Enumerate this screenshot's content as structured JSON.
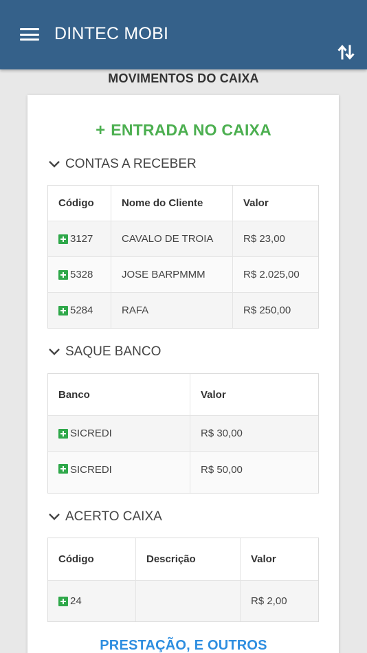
{
  "appbar": {
    "title": "DINTEC MOBI",
    "menu_icon": "hamburger-menu-icon",
    "sort_icon": "swap-vertical-icon",
    "color": "#35618a"
  },
  "page": {
    "title": "MOVIMENTOS DO CAIXA"
  },
  "entry": {
    "plus": "+",
    "title": "ENTRADA NO CAIXA",
    "color": "#4caf50"
  },
  "contas_receber": {
    "title": "CONTAS A RECEBER",
    "columns": [
      "Código",
      "Nome do Cliente",
      "Valor"
    ],
    "rows": [
      {
        "codigo": "3127",
        "nome": "CAVALO DE TROIA",
        "valor": "R$ 23,00"
      },
      {
        "codigo": "5328",
        "nome": "JOSE BARPMMM",
        "valor": "R$ 2.025,00"
      },
      {
        "codigo": "5284",
        "nome": "RAFA",
        "valor": "R$ 250,00"
      }
    ]
  },
  "saque_banco": {
    "title": "SAQUE BANCO",
    "columns": [
      "Banco",
      "Valor"
    ],
    "rows": [
      {
        "banco": "SICREDI",
        "valor": "R$ 30,00"
      },
      {
        "banco": "SICREDI",
        "valor": "R$ 50,00"
      }
    ]
  },
  "acerto_caixa": {
    "title": "ACERTO CAIXA",
    "columns": [
      "Código",
      "Descrição",
      "Valor"
    ],
    "rows": [
      {
        "codigo": "24",
        "descricao": "",
        "valor": "R$ 2,00"
      }
    ]
  },
  "footer_link": {
    "label": "PRESTAÇÃO, E OUTROS",
    "color": "#2e8ee0"
  }
}
